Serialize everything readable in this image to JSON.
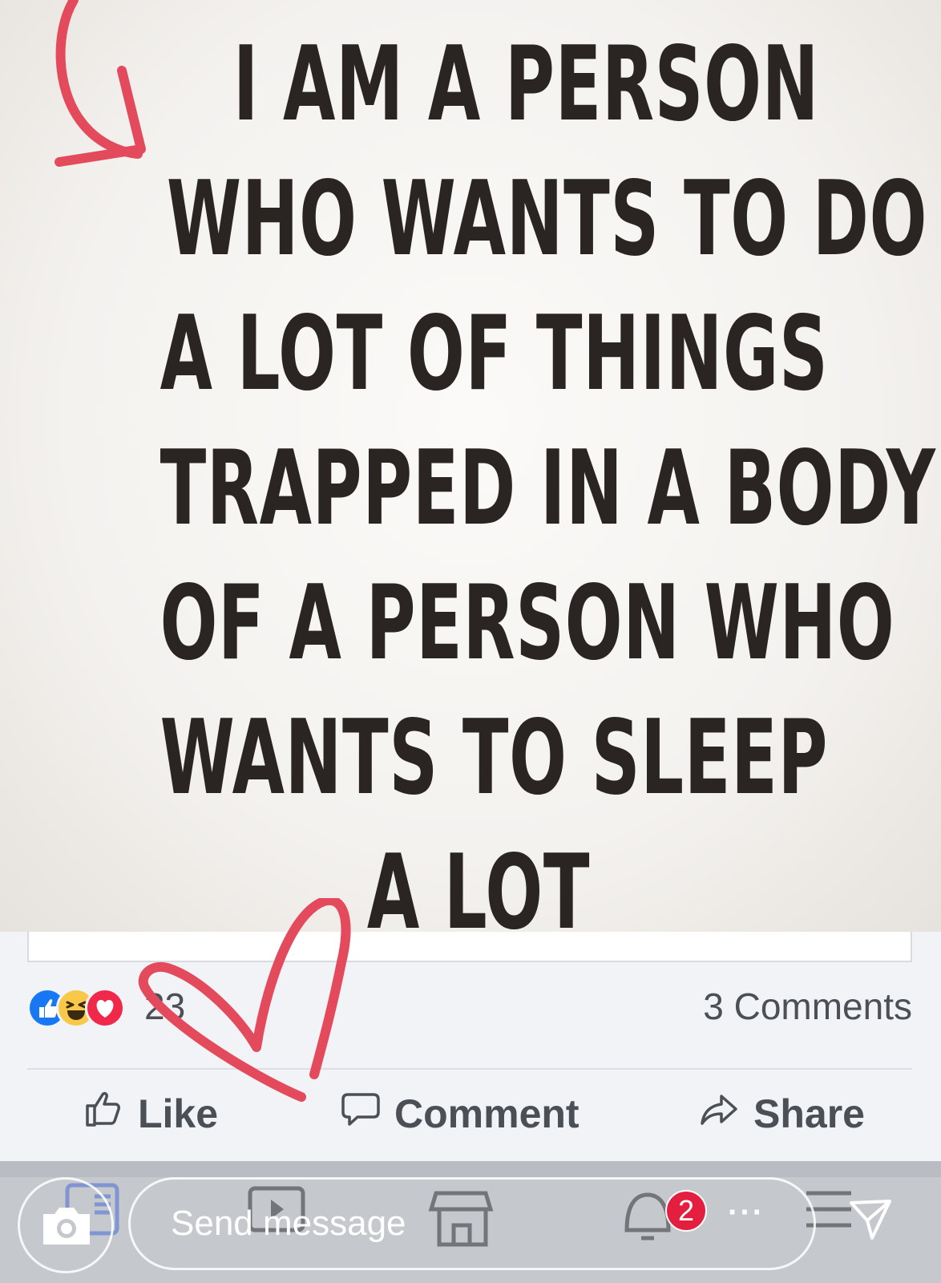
{
  "meme": {
    "lines": [
      "I AM A PERSON",
      "WHO WANTS TO DO",
      "A LOT OF THINGS",
      "TRAPPED IN A BODY",
      "OF A PERSON WHO",
      "WANTS TO SLEEP",
      "A LOT"
    ]
  },
  "post": {
    "reaction_count": "23",
    "comments_label": "3 Comments",
    "reactions": [
      "like-icon",
      "haha-icon",
      "love-icon"
    ],
    "actions": {
      "like_label": "Like",
      "comment_label": "Comment",
      "share_label": "Share"
    }
  },
  "bottom_bar": {
    "message_placeholder": "Send message",
    "notification_count": "2",
    "more_label": "···"
  },
  "colors": {
    "doodle": "#e34a5c",
    "like_blue": "#1877f2",
    "love_red": "#f02849",
    "haha_yellow": "#f7c84a"
  }
}
